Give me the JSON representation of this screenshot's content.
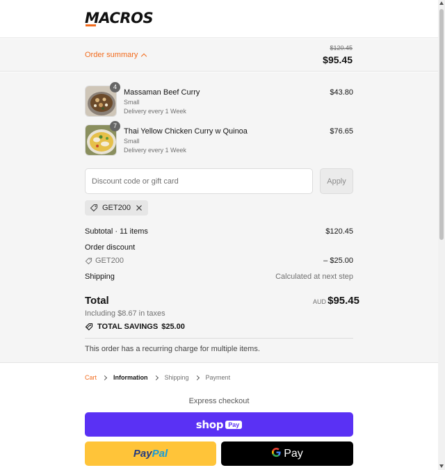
{
  "brand": {
    "name": "MACROS",
    "accent_color": "#f26b1d"
  },
  "summary_bar": {
    "toggle_label": "Order summary",
    "toggle_icon": "chevron-up-icon",
    "original_total": "$120.45",
    "total": "$95.45"
  },
  "line_items": [
    {
      "name": "Massaman Beef Curry",
      "quantity": "4",
      "variant": "Small",
      "frequency": "Delivery every 1 Week",
      "price": "$43.80"
    },
    {
      "name": "Thai Yellow Chicken Curry w Quinoa",
      "quantity": "7",
      "variant": "Small",
      "frequency": "Delivery every 1 Week",
      "price": "$76.65"
    }
  ],
  "discount": {
    "placeholder": "Discount code or gift card",
    "apply_label": "Apply",
    "applied_code": "GET200"
  },
  "totals": {
    "subtotal_label": "Subtotal · 11 items",
    "subtotal_value": "$120.45",
    "order_discount_label": "Order discount",
    "discount_code": "GET200",
    "discount_value": "– $25.00",
    "shipping_label": "Shipping",
    "shipping_value": "Calculated at next step",
    "total_label": "Total",
    "currency": "AUD",
    "total_value": "$95.45",
    "taxes_note": "Including $8.67 in taxes",
    "savings_label": "TOTAL SAVINGS",
    "savings_value": "$25.00",
    "recurring_note": "This order has a recurring charge for multiple items."
  },
  "breadcrumb": {
    "items": [
      "Cart",
      "Information",
      "Shipping",
      "Payment"
    ]
  },
  "express": {
    "label": "Express checkout",
    "shop_word": "shop",
    "shop_badge": "Pay",
    "paypal_part1": "Pay",
    "paypal_part2": "Pal",
    "gpay_g": "G",
    "gpay_word": "Pay"
  }
}
